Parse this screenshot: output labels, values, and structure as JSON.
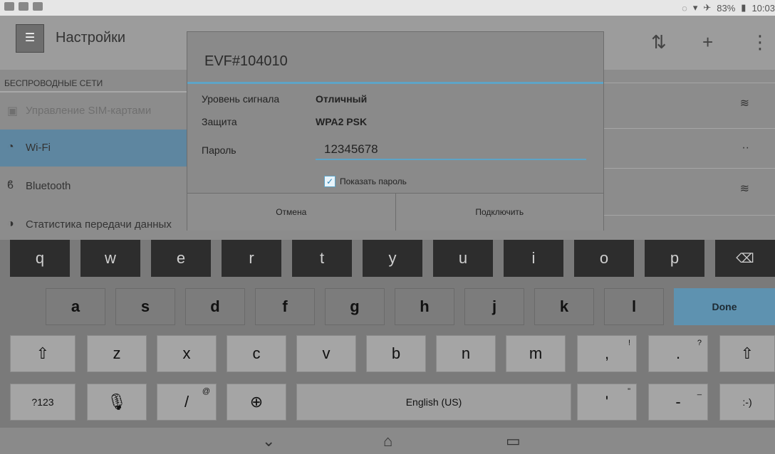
{
  "status_bar": {
    "battery": "83%",
    "time": "10:03"
  },
  "action_bar": {
    "title": "Настройки"
  },
  "settings": {
    "section_header": "БЕСПРОВОДНЫЕ СЕТИ",
    "items": [
      {
        "label": "Управление SIM-картами",
        "icon": "sim-icon"
      },
      {
        "label": "Wi-Fi",
        "icon": "wifi-icon"
      },
      {
        "label": "Bluetooth",
        "icon": "bluetooth-icon"
      },
      {
        "label": "Статистика передачи данных",
        "icon": "data-usage-icon"
      }
    ],
    "partial_text": "Wi-Fi"
  },
  "dialog": {
    "title": "EVF#104010",
    "signal_label": "Уровень сигнала",
    "signal_value": "Отличный",
    "security_label": "Защита",
    "security_value": "WPA2 PSK",
    "password_label": "Пароль",
    "password_value": "12345678",
    "show_password_label": "Показать пароль",
    "show_password_checked": true,
    "cancel_label": "Отмена",
    "connect_label": "Подключить"
  },
  "keyboard": {
    "row1": [
      "q",
      "w",
      "e",
      "r",
      "t",
      "y",
      "u",
      "i",
      "o",
      "p"
    ],
    "row2": [
      "a",
      "s",
      "d",
      "f",
      "g",
      "h",
      "j",
      "k",
      "l"
    ],
    "row3": [
      "z",
      "x",
      "c",
      "v",
      "b",
      "n",
      "m"
    ],
    "comma_key": ",",
    "comma_hint": "!",
    "period_key": ".",
    "period_hint": "?",
    "done_label": "Done",
    "symbols_label": "?123",
    "slash_key": "/",
    "slash_hint": "@",
    "space_label": "English (US)",
    "apostrophe_key": "'",
    "apostrophe_hint": "\"",
    "dash_key": "-",
    "dash_hint": "_",
    "smiley_label": ":-)",
    "backspace_icon": "backspace-icon",
    "shift_icon": "shift-icon",
    "mic_icon": "mic-icon",
    "globe_icon": "globe-icon"
  },
  "nav_bar": {
    "back_icon": "back-icon",
    "home_icon": "home-icon",
    "recents_icon": "recents-icon"
  }
}
